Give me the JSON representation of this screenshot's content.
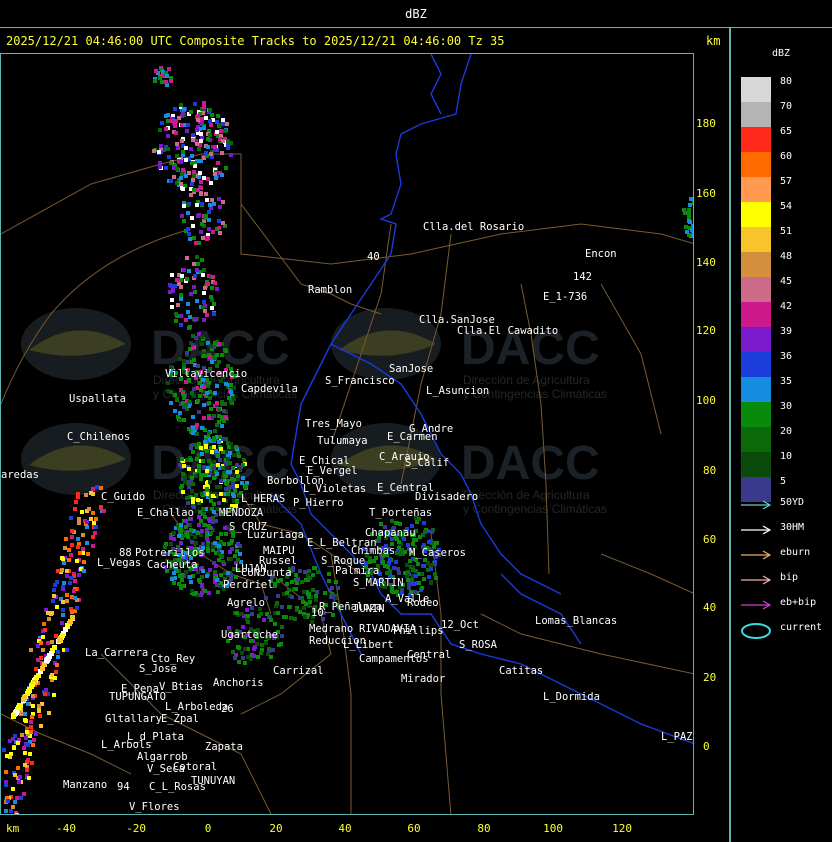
{
  "header": {
    "title": "dBZ"
  },
  "map_title": "2025/12/21 04:46:00 UTC Composite Tracks to 2025/12/21 04:46:00 Tz 35",
  "axis_unit_label": "km",
  "y_ticks": [
    "180",
    "160",
    "140",
    "120",
    "100",
    "80",
    "60",
    "40",
    "20",
    "0"
  ],
  "x_ticks": [
    "-40",
    "-20",
    "0",
    "20",
    "40",
    "60",
    "80",
    "100",
    "120"
  ],
  "legend": {
    "title": "dBZ",
    "scale": [
      {
        "label": "80",
        "color": "#d8d8d8"
      },
      {
        "label": "70",
        "color": "#b4b4b4"
      },
      {
        "label": "65",
        "color": "#ff2a1a"
      },
      {
        "label": "60",
        "color": "#ff6a00"
      },
      {
        "label": "57",
        "color": "#ff9a50"
      },
      {
        "label": "54",
        "color": "#ffff00"
      },
      {
        "label": "51",
        "color": "#f7c42a"
      },
      {
        "label": "48",
        "color": "#d48f3c"
      },
      {
        "label": "45",
        "color": "#cc6b88"
      },
      {
        "label": "42",
        "color": "#cc1a8c"
      },
      {
        "label": "39",
        "color": "#7a1acc"
      },
      {
        "label": "36",
        "color": "#1a3ddc"
      },
      {
        "label": "35",
        "color": "#168ce0"
      },
      {
        "label": "30",
        "color": "#0a8a0a"
      },
      {
        "label": "20",
        "color": "#0a6a0a"
      },
      {
        "label": "10",
        "color": "#0a4a0a"
      },
      {
        "label": "5",
        "color": "#3a3a8c"
      }
    ],
    "tracks": [
      {
        "label": "50YD",
        "color": "#5fd0d0"
      },
      {
        "label": "30HM",
        "color": "#ffffff"
      },
      {
        "label": "eburn",
        "color": "#e6b070"
      },
      {
        "label": "bip",
        "color": "#f0b0b0"
      },
      {
        "label": "eb+bip",
        "color": "#d040d0"
      },
      {
        "label": "current",
        "color": "#3ad8e0"
      }
    ]
  },
  "watermark": {
    "brand": "DACC",
    "line1": "Dirección de Agricultura",
    "line2": "y Contingencias Climáticas"
  },
  "places": [
    "Clla.del Rosario",
    "Encon",
    "E_1-736",
    "Ramblon",
    "Clla.SanJose",
    "Clla.El Cawadito",
    "Villavicencio",
    "Capdevila",
    "S_Francisco",
    "SanJose",
    "L_Asuncion",
    "Uspallata",
    "Tres_Mayo",
    "Tulumaya",
    "E_Carmen",
    "G_Andre",
    "C_Chilenos",
    "E_Chical",
    "C_Arauio",
    "S_Calif",
    "E_Vergel",
    "Borbollon",
    "L_Violetas",
    "E_Central",
    "Divisadero",
    "C_Guido",
    "P_Hierro",
    "L_HERAS",
    "E_Challao",
    "MENDOZA",
    "T_Porteñas",
    "S_CRUZ",
    "Luzuriaga",
    "E_L_Beltran",
    "Chapanau",
    "Potrerillos",
    "L_Vegas",
    "Cacheuta",
    "MAIPU",
    "Russel",
    "Chimbas",
    "M_Caseros",
    "LUJAN",
    "CUNJunta",
    "S_Roque",
    "Palmira",
    "Perdriel",
    "S_MARTIN",
    "Agrelo",
    "R_Peñaloza",
    "JUNIN",
    "A_Valle",
    "Rodeo",
    "Ugarteche",
    "Medrano",
    "RIVADAVIA",
    "Phillips",
    "12_Oct",
    "Lomas_Blancas",
    "La_Carrera",
    "Cto_Rey",
    "Reduccion",
    "L_Libert",
    "S_ROSA",
    "S_Jose",
    "Campamentos",
    "Central",
    "Carrizal",
    "Catitas",
    "E_Pena",
    "V_Btias",
    "Anchoris",
    "Mirador",
    "TUPUNGATO",
    "L_Arboleda",
    "L_Dormida",
    "Gltallary",
    "E_Zpal",
    "L_d_Plata",
    "L_Arbols",
    "Zapata",
    "L_PAZ",
    "Algarrob",
    "V_Seca",
    "Cotoral",
    "TUNUYAN",
    "Manzano",
    "C_L_Rosas",
    "V_Flores",
    "aredas",
    "142",
    "40",
    "94",
    "88",
    "10",
    "26"
  ]
}
